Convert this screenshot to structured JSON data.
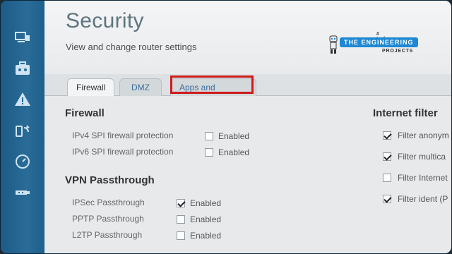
{
  "header": {
    "title": "Security",
    "subtitle": "View and change router settings"
  },
  "logo": {
    "tag": "# techopreneur",
    "brand": "THE ENGINEERING",
    "projects": "PROJECTS"
  },
  "sidebar": {
    "items": [
      {
        "icon": "computer-router-icon"
      },
      {
        "icon": "toolbox-icon"
      },
      {
        "icon": "warning-triangle-icon"
      },
      {
        "icon": "connectivity-arrows-icon"
      },
      {
        "icon": "clock-icon"
      },
      {
        "icon": "usb-icon"
      }
    ]
  },
  "tabs": [
    {
      "label": "Firewall",
      "active": true
    },
    {
      "label": "DMZ",
      "active": false
    },
    {
      "label": "Apps and Gaming",
      "active": false
    }
  ],
  "firewall": {
    "heading": "Firewall",
    "rows": [
      {
        "label": "IPv4 SPI firewall protection",
        "value_label": "Enabled",
        "checked": false
      },
      {
        "label": "IPv6 SPI firewall protection",
        "value_label": "Enabled",
        "checked": false
      }
    ]
  },
  "vpn": {
    "heading": "VPN Passthrough",
    "rows": [
      {
        "label": "IPSec Passthrough",
        "value_label": "Enabled",
        "checked": true
      },
      {
        "label": "PPTP Passthrough",
        "value_label": "Enabled",
        "checked": false
      },
      {
        "label": "L2TP Passthrough",
        "value_label": "Enabled",
        "checked": false
      }
    ]
  },
  "internet_filters": {
    "heading": "Internet filter",
    "rows": [
      {
        "label": "Filter anonym",
        "checked": true
      },
      {
        "label": "Filter multica",
        "checked": true
      },
      {
        "label": "Filter Internet",
        "checked": false
      },
      {
        "label": "Filter ident (P",
        "checked": true
      }
    ]
  },
  "colors": {
    "sidebar": "#2a6c98",
    "highlight": "#cc1b1b",
    "tab_link": "#3d6e9c"
  }
}
